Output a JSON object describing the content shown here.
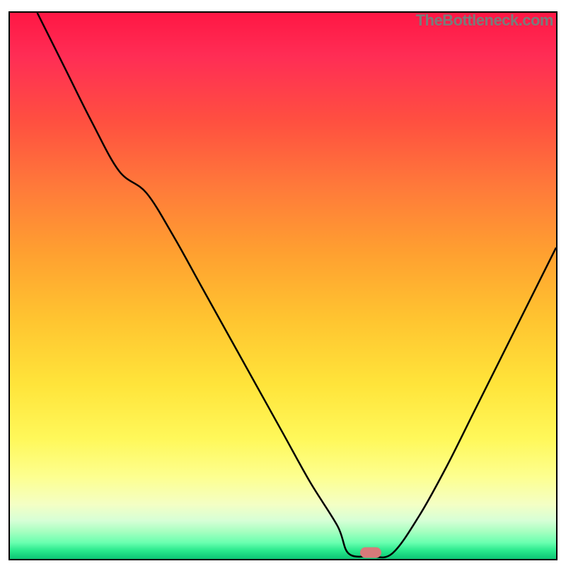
{
  "watermark": "TheBottleneck.com",
  "frame": {
    "border_color": "#000000"
  },
  "marker": {
    "x_pct": 66,
    "y_pct": 98.8,
    "color": "#d87a7a"
  },
  "chart_data": {
    "type": "line",
    "title": "",
    "xlabel": "",
    "ylabel": "",
    "xlim": [
      0,
      100
    ],
    "ylim": [
      0,
      100
    ],
    "grid": false,
    "legend": false,
    "gradient_stops": [
      {
        "pct": 0,
        "color": "#ff1744"
      },
      {
        "pct": 8,
        "color": "#ff2d55"
      },
      {
        "pct": 20,
        "color": "#ff5040"
      },
      {
        "pct": 32,
        "color": "#ff7a3a"
      },
      {
        "pct": 44,
        "color": "#ffa030"
      },
      {
        "pct": 56,
        "color": "#ffc430"
      },
      {
        "pct": 68,
        "color": "#ffe43a"
      },
      {
        "pct": 78,
        "color": "#fff85a"
      },
      {
        "pct": 85,
        "color": "#fdff90"
      },
      {
        "pct": 90,
        "color": "#f4ffc4"
      },
      {
        "pct": 93,
        "color": "#d6ffd6"
      },
      {
        "pct": 95,
        "color": "#a6ffc0"
      },
      {
        "pct": 97,
        "color": "#6affb0"
      },
      {
        "pct": 98.5,
        "color": "#28e88c"
      },
      {
        "pct": 100,
        "color": "#0cc474"
      }
    ],
    "series": [
      {
        "name": "bottleneck-curve",
        "color": "#000000",
        "x": [
          5,
          10,
          15,
          20,
          25,
          30,
          35,
          40,
          45,
          50,
          55,
          60,
          62,
          66,
          70,
          75,
          80,
          85,
          90,
          95,
          100
        ],
        "y": [
          100,
          90,
          80,
          71,
          67,
          59,
          50,
          41,
          32,
          23,
          14,
          6,
          1,
          0.5,
          1,
          8,
          17,
          27,
          37,
          47,
          57
        ]
      }
    ],
    "marker": {
      "x": 66,
      "y": 0.5
    }
  }
}
